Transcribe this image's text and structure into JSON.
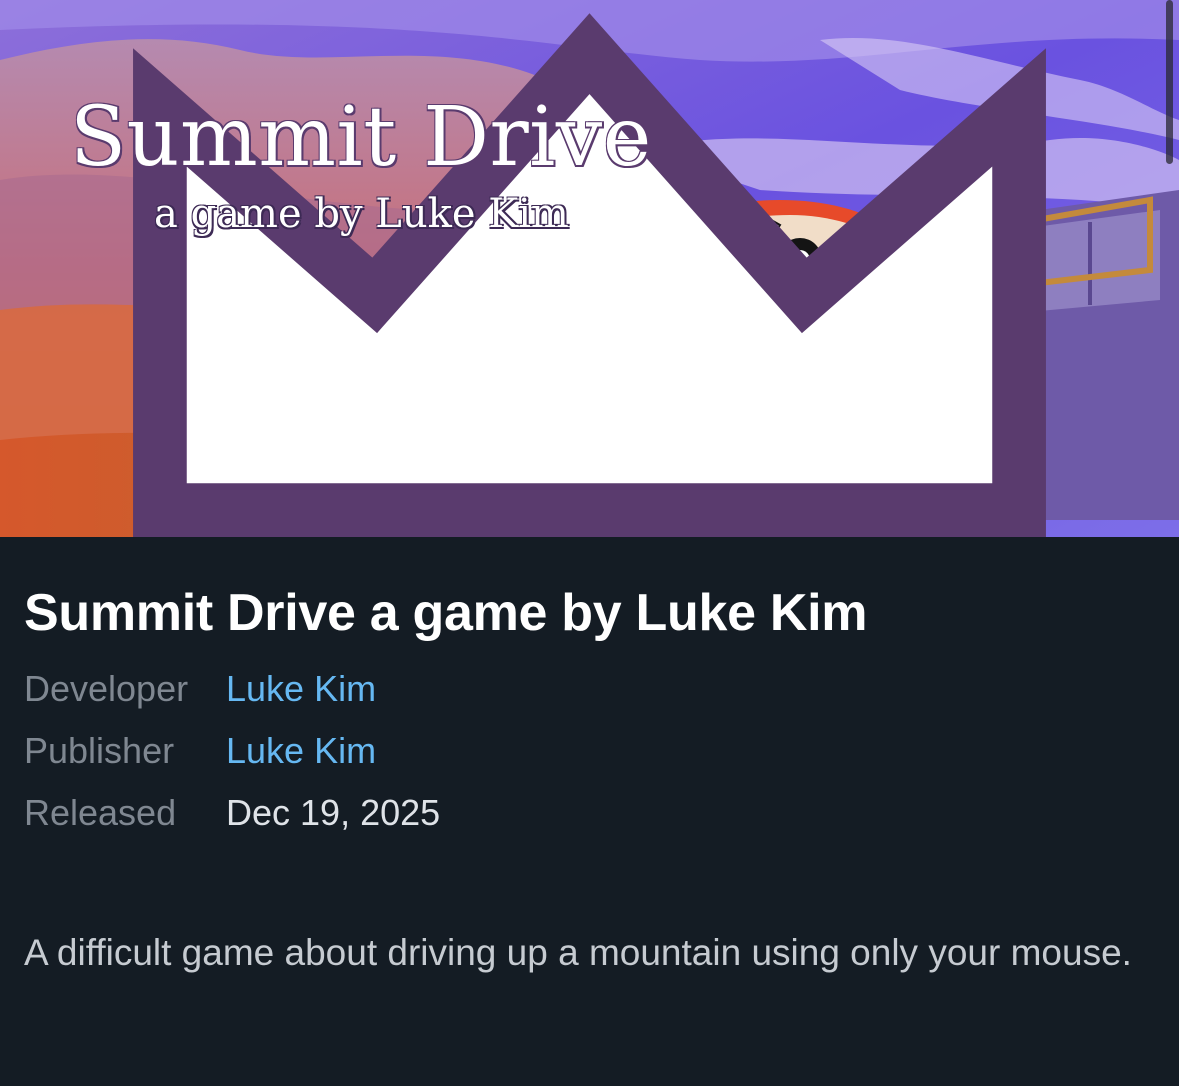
{
  "hero": {
    "title": "Summit Drive",
    "subtitle": "a game by Luke Kim"
  },
  "game": {
    "title": "Summit Drive a game by Luke Kim",
    "developer_label": "Developer",
    "developer": "Luke Kim",
    "publisher_label": "Publisher",
    "publisher": "Luke Kim",
    "released_label": "Released",
    "released": "Dec 19, 2025",
    "description": "A difficult game about driving up a mountain using only your mouse."
  },
  "colors": {
    "background": "#141c24",
    "link": "#66b8f2",
    "label": "#7f8791",
    "title": "#ffffff"
  }
}
